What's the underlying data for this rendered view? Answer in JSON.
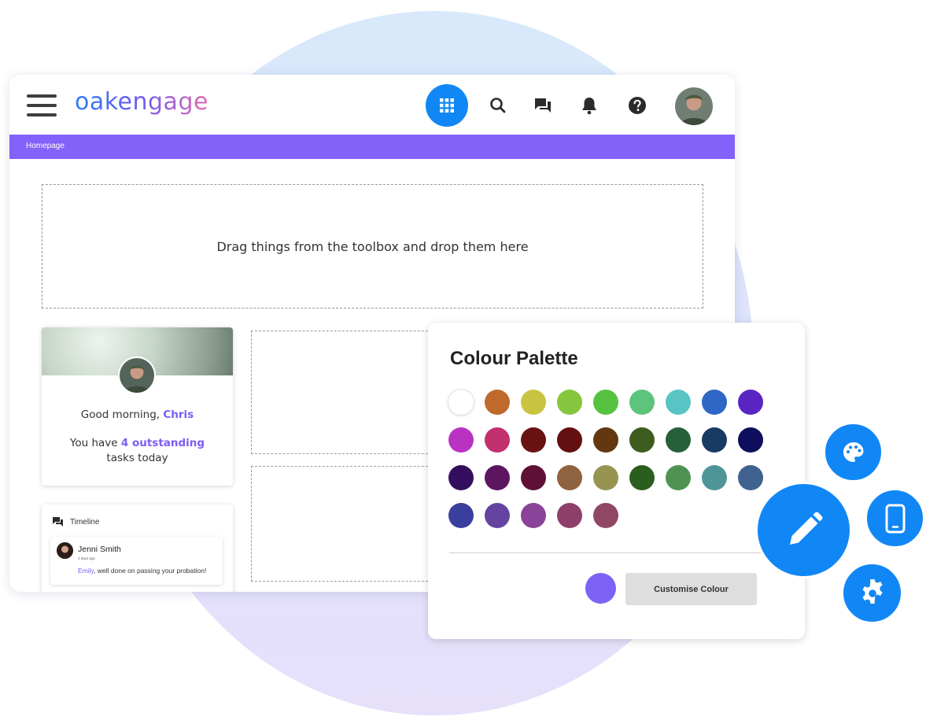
{
  "app": {
    "logo_text": "oakengage",
    "breadcrumb": "Homepage"
  },
  "header": {
    "icons": [
      "menu-icon",
      "apps-grid-icon",
      "search-icon",
      "chat-icon",
      "bell-icon",
      "help-icon",
      "user-avatar"
    ]
  },
  "dropzone": {
    "text": "Drag things from the toolbox and drop them here"
  },
  "welcome": {
    "greeting_prefix": "Good morning, ",
    "user_name": "Chris",
    "tasks_prefix": "You have ",
    "tasks_highlight": "4 outstanding",
    "tasks_suffix": "tasks today"
  },
  "timeline": {
    "title": "Timeline",
    "items": [
      {
        "name": "Jenni Smith",
        "time": "3 days ago",
        "mention": "Emily",
        "message": ", well done on passing your probation!"
      }
    ]
  },
  "palette": {
    "title": "Colour Palette",
    "swatches": [
      "#ffffff",
      "#bf6a2c",
      "#c9c441",
      "#86c63e",
      "#57c23f",
      "#5cc47b",
      "#58c4c3",
      "#2e67c5",
      "#5a25c3",
      "#b933c3",
      "#c2306e",
      "#6a1212",
      "#631010",
      "#633712",
      "#3e5c1e",
      "#256039",
      "#193a64",
      "#0f0e5e",
      "#340e5e",
      "#5e1560",
      "#5e1036",
      "#8f6240",
      "#969450",
      "#2b5e1e",
      "#4f9353",
      "#4f9598",
      "#3f6291",
      "#3a3f9d",
      "#6544a1",
      "#8a4399",
      "#8e3f6a",
      "#904763"
    ],
    "current_colour": "#7e62f6",
    "customise_label": "Customise Colour"
  },
  "colors": {
    "accent": "#8262f8",
    "primary_blue": "#1187f6"
  },
  "fab_icons": [
    "palette-icon",
    "edit-pencil-icon",
    "mobile-icon",
    "settings-gear-icon"
  ]
}
